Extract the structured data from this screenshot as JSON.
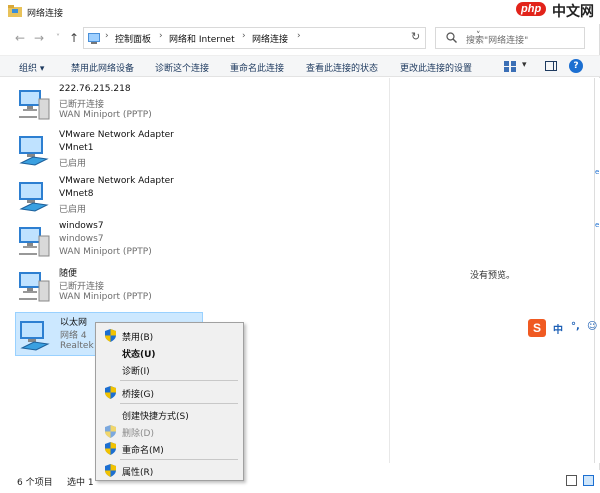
{
  "window": {
    "title": "网络连接"
  },
  "watermark": {
    "brand": "php",
    "text": "中文网"
  },
  "address": {
    "breadcrumbs": [
      "控制面板",
      "网络和 Internet",
      "网络连接"
    ],
    "separator": "›"
  },
  "search": {
    "placeholder": "搜索\"网络连接\""
  },
  "toolbar": {
    "organize": "组织 ▾",
    "items": [
      "禁用此网络设备",
      "诊断这个连接",
      "重命名此连接",
      "查看此连接的状态",
      "更改此连接的设置"
    ],
    "view_dropdown": "▾",
    "help": "?"
  },
  "connections": [
    {
      "name": "222.76.215.218",
      "status": "已断开连接",
      "device": "WAN Miniport (PPTP)"
    },
    {
      "name": "VMware Network Adapter",
      "status": "VMnet1",
      "device": "已启用"
    },
    {
      "name": "VMware Network Adapter",
      "status": "VMnet8",
      "device": "已启用"
    },
    {
      "name": "windows7",
      "status": "windows7",
      "device": "WAN Miniport (PPTP)"
    },
    {
      "name": "随便",
      "status": "已断开连接",
      "device": "WAN Miniport (PPTP)"
    },
    {
      "name": "以太网",
      "status": "网络 4",
      "device": "Realtek P"
    }
  ],
  "preview": {
    "empty_text": "没有预览。"
  },
  "status_bar": {
    "count": "6 个项目",
    "selected": "选中 1"
  },
  "context_menu": {
    "items": [
      {
        "label": "禁用(B)",
        "shield": true,
        "bold": false,
        "disabled": false
      },
      {
        "label": "状态(U)",
        "shield": false,
        "bold": true,
        "disabled": false
      },
      {
        "label": "诊断(I)",
        "shield": false,
        "bold": false,
        "disabled": false
      },
      {
        "label": "桥接(G)",
        "shield": true,
        "bold": false,
        "disabled": false
      },
      {
        "label": "创建快捷方式(S)",
        "shield": false,
        "bold": false,
        "disabled": false
      },
      {
        "label": "删除(D)",
        "shield": true,
        "bold": false,
        "disabled": true
      },
      {
        "label": "重命名(M)",
        "shield": true,
        "bold": false,
        "disabled": false
      },
      {
        "label": "属性(R)",
        "shield": true,
        "bold": false,
        "disabled": false
      }
    ]
  },
  "ime": {
    "logo": "S",
    "mode": "中",
    "punct": "°,",
    "emoji": "☺"
  },
  "edge_marks": [
    "e",
    "e"
  ],
  "colors": {
    "accent": "#1c6fd1",
    "selection": "#cce8ff",
    "menu_bg": "#f0f0f0"
  }
}
